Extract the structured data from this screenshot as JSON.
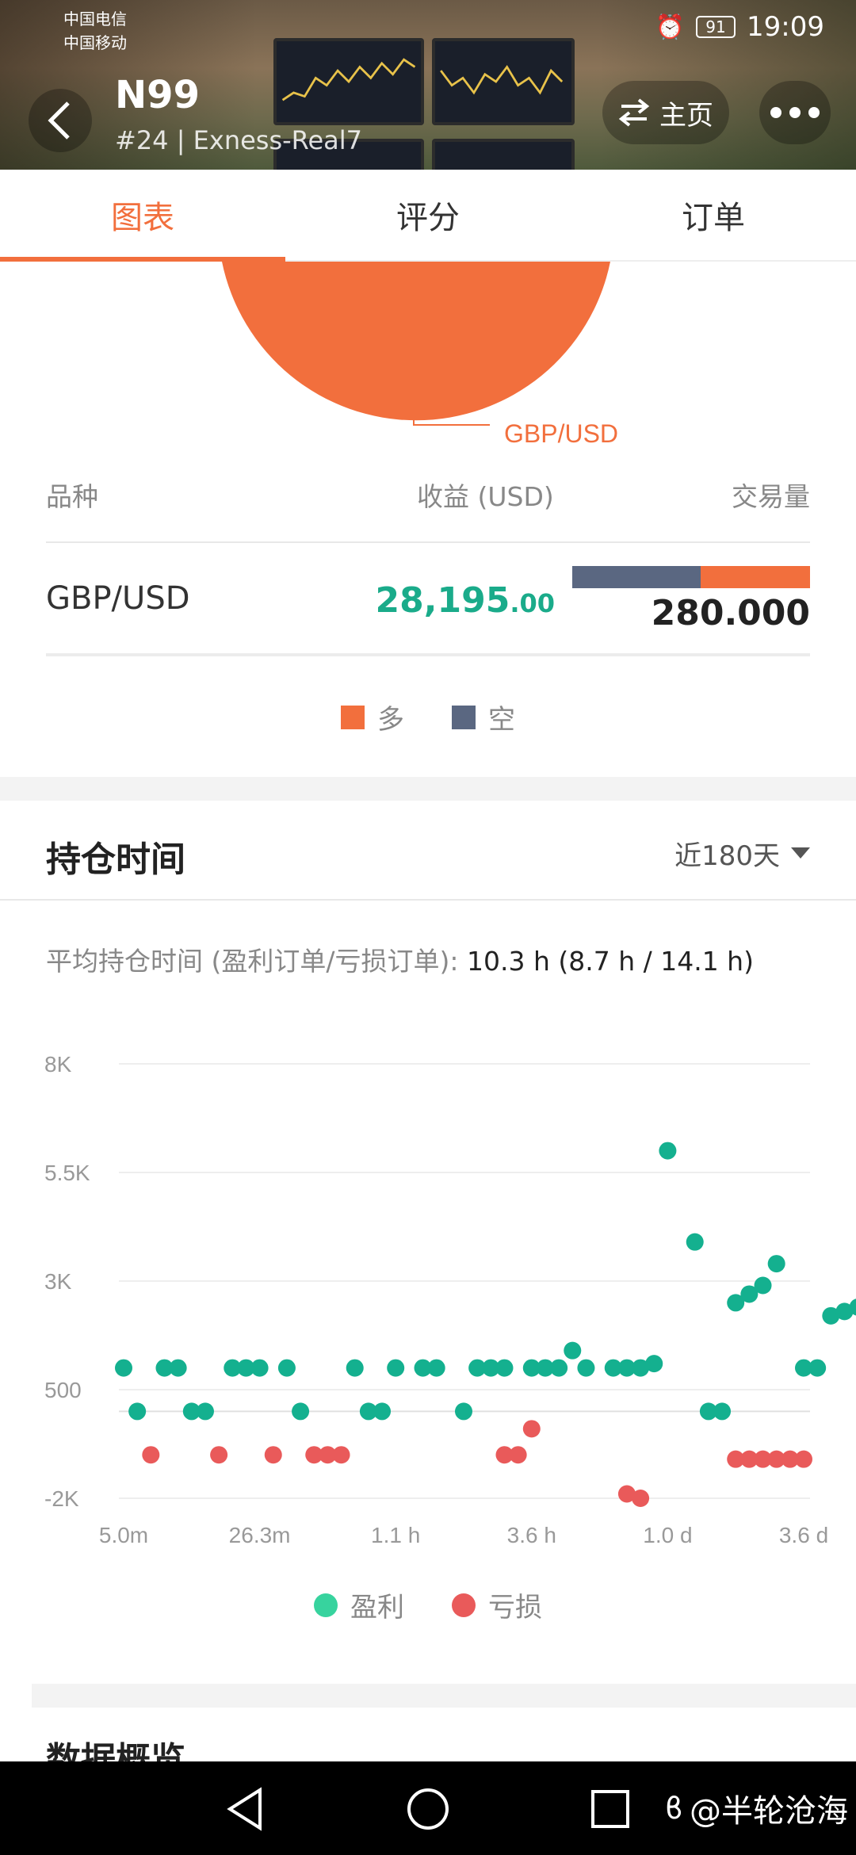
{
  "status_bar": {
    "carrier1": "中国电信",
    "carrier2": "中国移动",
    "battery": "91",
    "time": "19:09"
  },
  "header": {
    "title": "N99",
    "subtitle": "#24 | Exness-Real7",
    "home_label": "主页"
  },
  "tabs": [
    {
      "label": "图表",
      "active": true
    },
    {
      "label": "评分",
      "active": false
    },
    {
      "label": "订单",
      "active": false
    }
  ],
  "pie": {
    "label": "GBP/USD",
    "color": "#f26f3d"
  },
  "symbols_table": {
    "headers": {
      "symbol": "品种",
      "profit": "收益 (USD)",
      "volume": "交易量"
    },
    "rows": [
      {
        "symbol": "GBP/USD",
        "profit_main": "28,195",
        "profit_decimals": ".00",
        "volume": "280.000",
        "short_fraction": 0.54,
        "long_fraction": 0.46
      }
    ],
    "legend": [
      {
        "label": "多",
        "color": "#f26f3d"
      },
      {
        "label": "空",
        "color": "#5a6781"
      }
    ]
  },
  "holding": {
    "title": "持仓时间",
    "period": "近180天",
    "avg_label": "平均持仓时间 (盈利订单/亏损订单):",
    "avg_value": "10.3 h (8.7 h / 14.1 h)",
    "legend": [
      {
        "label": "盈利",
        "color": "#1aab8a"
      },
      {
        "label": "亏损",
        "color": "#e95a5a"
      }
    ]
  },
  "chart_data": {
    "type": "scatter",
    "title": "",
    "xlabel": "",
    "ylabel": "",
    "y_ticks": [
      "8K",
      "5.5K",
      "3K",
      "500",
      "-2K"
    ],
    "y_tick_values": [
      8000,
      5500,
      3000,
      500,
      -2000
    ],
    "ylim": [
      -2000,
      8000
    ],
    "x_ticks": [
      "5.0m",
      "26.3m",
      "1.1 h",
      "3.6 h",
      "1.0 d",
      "3.6 d"
    ],
    "x_scale": "log (holding time, ticks from 5.0m to 3.6 d)",
    "grid": true,
    "legend_position": "bottom",
    "series": [
      {
        "name": "盈利",
        "color": "#1aab8a",
        "x_index": [
          0.0,
          0.1,
          0.3,
          0.4,
          0.5,
          0.6,
          0.8,
          0.9,
          1.0,
          1.2,
          1.3,
          1.7,
          1.8,
          1.9,
          2.0,
          2.2,
          2.3,
          2.5,
          2.6,
          2.7,
          2.8,
          3.0,
          3.1,
          3.2,
          3.3,
          3.4,
          3.6,
          3.7,
          3.8,
          3.9,
          4.0,
          4.2,
          4.3,
          4.4,
          4.5,
          4.6,
          4.7,
          4.8,
          5.0,
          5.1,
          5.2,
          5.3,
          5.4,
          5.6
        ],
        "values": [
          1000,
          0,
          1000,
          1000,
          0,
          0,
          1000,
          1000,
          1000,
          1000,
          0,
          1000,
          0,
          0,
          1000,
          1000,
          1000,
          0,
          1000,
          1000,
          1000,
          1000,
          1000,
          1000,
          1400,
          1000,
          1000,
          1000,
          1000,
          1100,
          6000,
          3900,
          0,
          0,
          2500,
          2700,
          2900,
          3400,
          1000,
          1000,
          2200,
          2300,
          2400,
          1000
        ],
        "note": "approximate profits (USD) read from chart"
      },
      {
        "name": "亏损",
        "color": "#e95a5a",
        "x_index": [
          0.2,
          0.7,
          1.1,
          1.4,
          1.5,
          1.6,
          2.8,
          2.9,
          3.0,
          3.7,
          3.8,
          4.5,
          4.6,
          4.7,
          4.8,
          4.9,
          5.0,
          5.7
        ],
        "values": [
          -1000,
          -1000,
          -1000,
          -1000,
          -1000,
          -1000,
          -1000,
          -1000,
          -400,
          -1900,
          -2000,
          -1100,
          -1100,
          -1100,
          -1100,
          -1100,
          -1100,
          -400
        ],
        "note": "approximate losses (USD) read from chart"
      }
    ]
  },
  "next_section": {
    "title": "数据概览"
  },
  "watermark": "@半轮沧海"
}
